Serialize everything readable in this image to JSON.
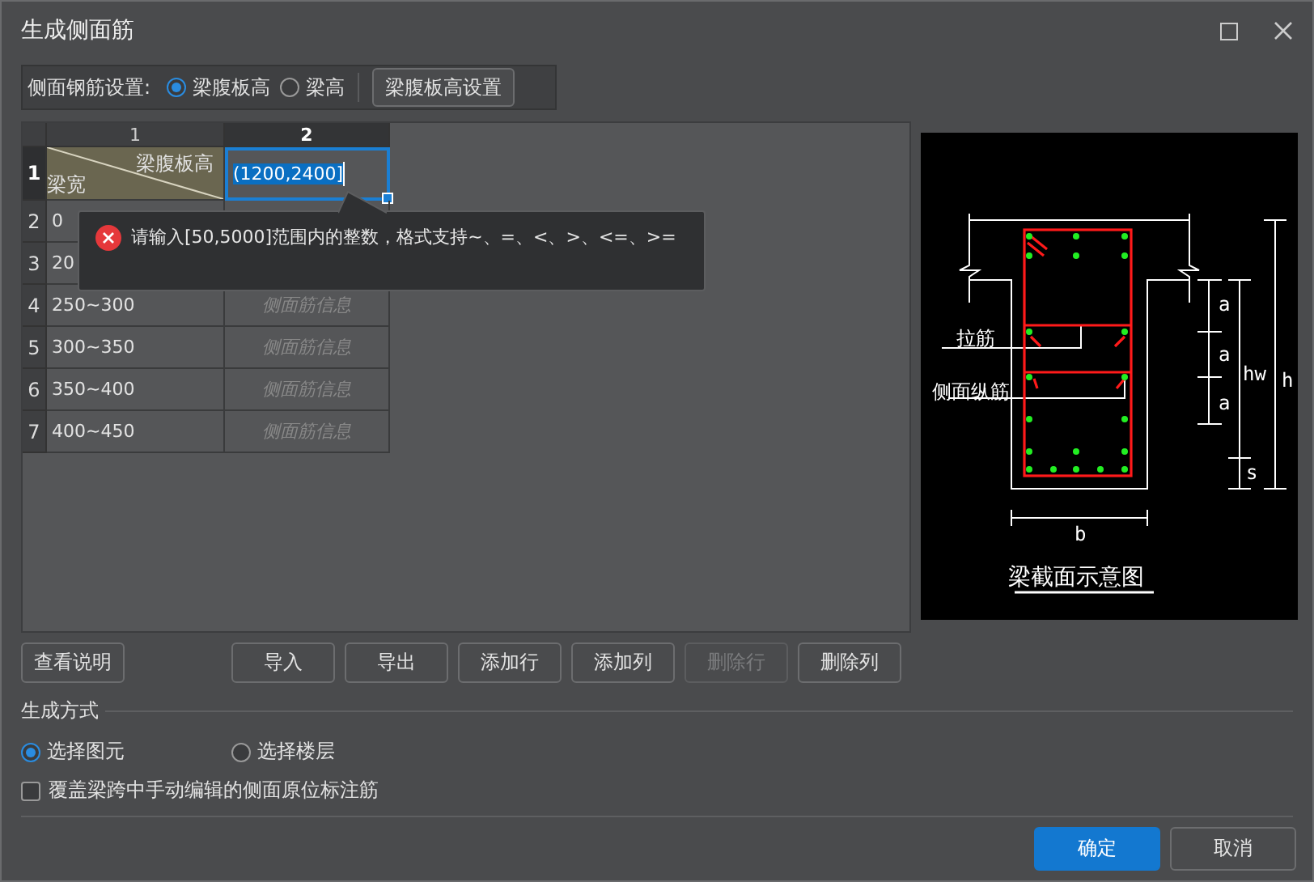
{
  "window": {
    "title": "生成侧面筋"
  },
  "rebar_setting": {
    "label": "侧面钢筋设置:",
    "options": [
      {
        "label": "梁腹板高",
        "selected": true
      },
      {
        "label": "梁高",
        "selected": false
      }
    ],
    "button": "梁腹板高设置"
  },
  "table": {
    "columns": [
      {
        "label": "1",
        "selected": false
      },
      {
        "label": "2",
        "selected": true
      }
    ],
    "corner": {
      "top": "梁腹板高",
      "bottom": "梁宽"
    },
    "rows": [
      {
        "number": "1",
        "kind": "header",
        "value": "(1200,2400]",
        "editing": true
      },
      {
        "number": "2",
        "kind": "range",
        "range": "0"
      },
      {
        "number": "3",
        "kind": "range",
        "range": "20"
      },
      {
        "number": "4",
        "kind": "range",
        "range": "250~300",
        "placeholder": "侧面筋信息"
      },
      {
        "number": "5",
        "kind": "range",
        "range": "300~350",
        "placeholder": "侧面筋信息"
      },
      {
        "number": "6",
        "kind": "range",
        "range": "350~400",
        "placeholder": "侧面筋信息"
      },
      {
        "number": "7",
        "kind": "range",
        "range": "400~450",
        "placeholder": "侧面筋信息"
      }
    ]
  },
  "tooltip": {
    "kind": "error",
    "text": "请输入[50,5000]范围内的整数，格式支持~、=、<、>、<=、>="
  },
  "diagram": {
    "labels": [
      "拉筋",
      "侧面纵筋",
      "a",
      "a",
      "a",
      "hw",
      "h",
      "s",
      "b"
    ],
    "caption": "梁截面示意图"
  },
  "actions": [
    {
      "label": "查看说明",
      "disabled": false
    },
    {
      "label": "导入",
      "disabled": false
    },
    {
      "label": "导出",
      "disabled": false
    },
    {
      "label": "添加行",
      "disabled": false
    },
    {
      "label": "添加列",
      "disabled": false
    },
    {
      "label": "删除行",
      "disabled": true
    },
    {
      "label": "删除列",
      "disabled": false
    }
  ],
  "generation": {
    "title": "生成方式",
    "options": [
      {
        "label": "选择图元",
        "selected": true
      },
      {
        "label": "选择楼层",
        "selected": false
      }
    ]
  },
  "override": {
    "label": "覆盖梁跨中手动编辑的侧面原位标注筋",
    "checked": false
  },
  "footer": [
    {
      "label": "确定",
      "kind": "primary"
    },
    {
      "label": "取消",
      "kind": "normal"
    }
  ]
}
